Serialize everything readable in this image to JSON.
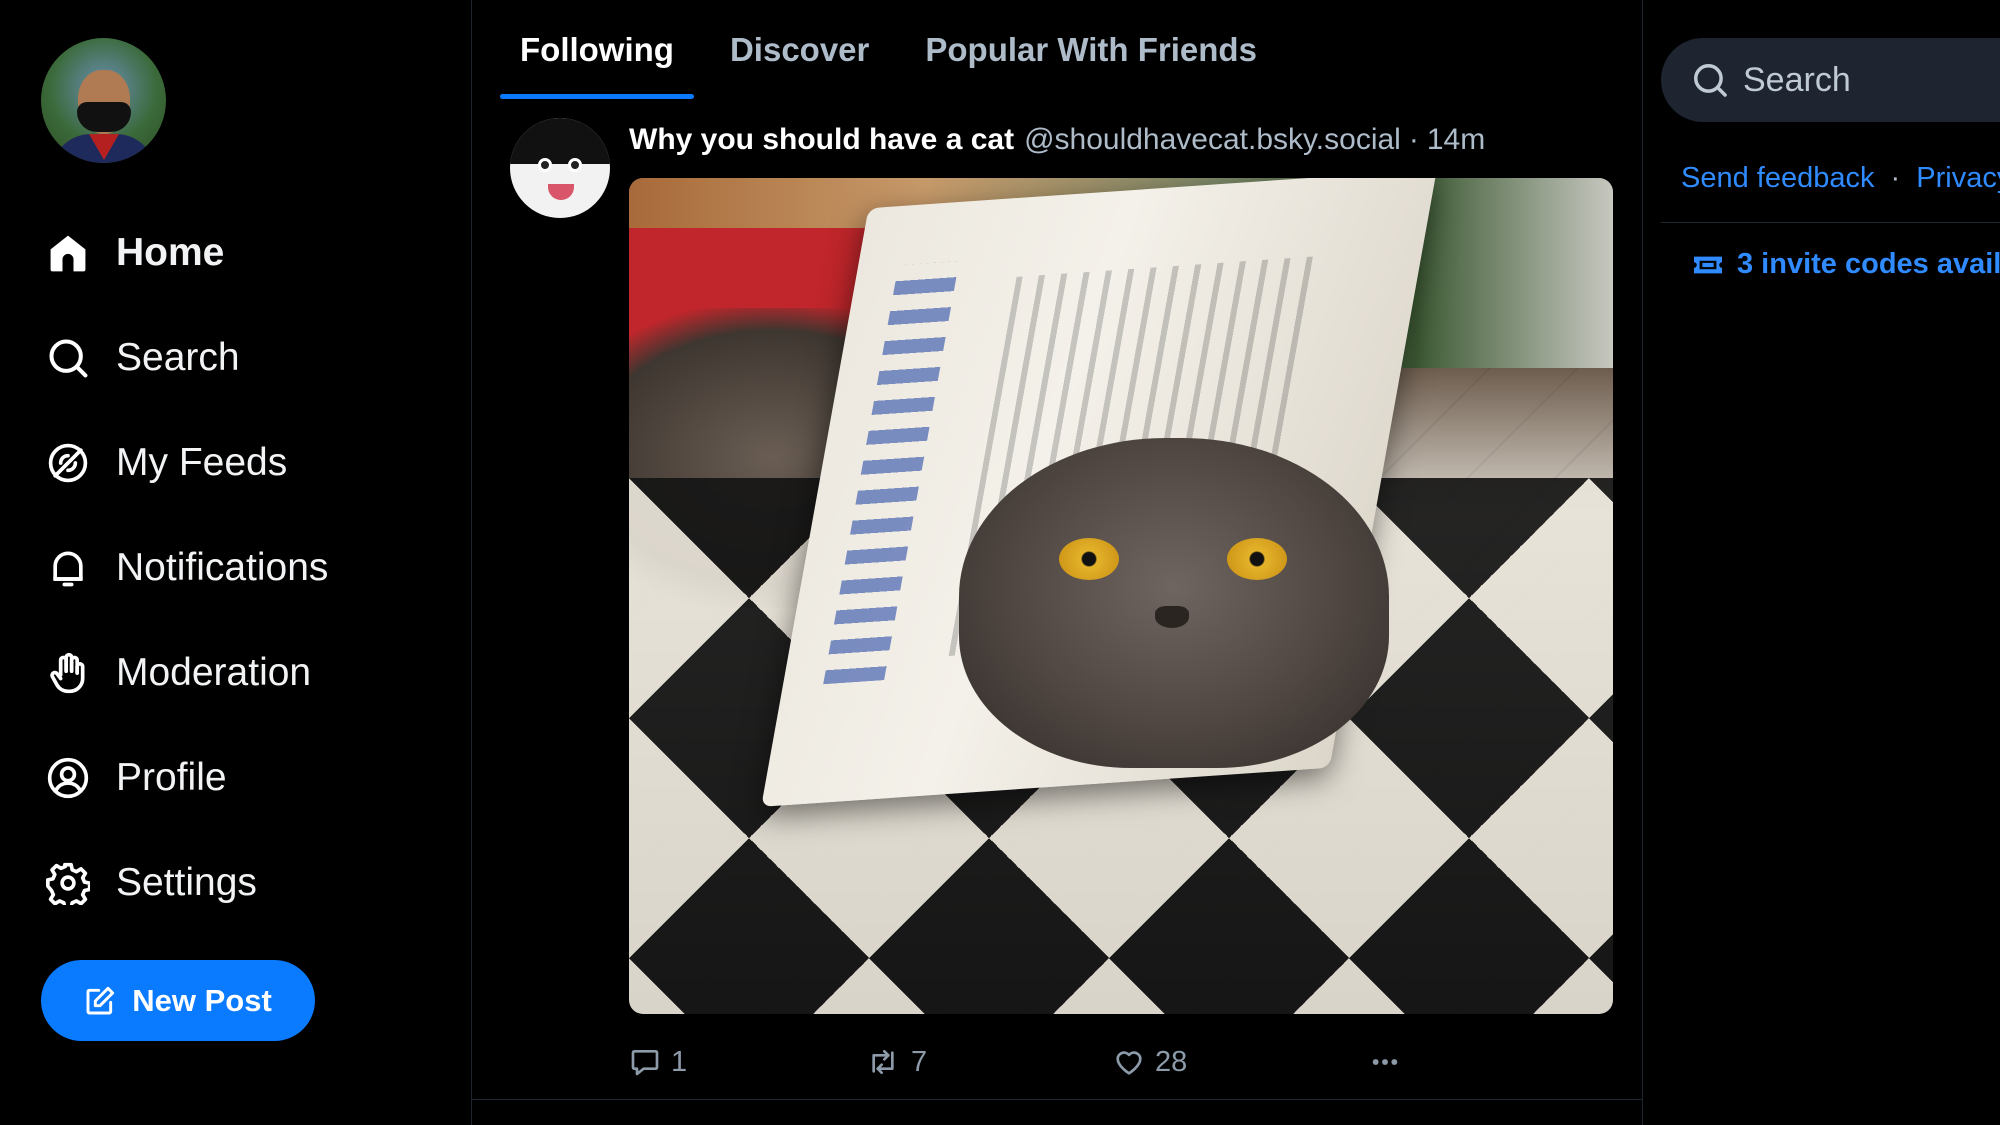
{
  "nav": {
    "items": [
      {
        "label": "Home",
        "icon": "home-icon",
        "active": true
      },
      {
        "label": "Search",
        "icon": "search-icon"
      },
      {
        "label": "My Feeds",
        "icon": "feeds-icon"
      },
      {
        "label": "Notifications",
        "icon": "bell-icon"
      },
      {
        "label": "Moderation",
        "icon": "hand-icon"
      },
      {
        "label": "Profile",
        "icon": "user-circle-icon"
      },
      {
        "label": "Settings",
        "icon": "gear-icon"
      }
    ],
    "new_post_label": "New Post"
  },
  "feed": {
    "tabs": [
      {
        "label": "Following",
        "active": true
      },
      {
        "label": "Discover"
      },
      {
        "label": "Popular With Friends"
      }
    ],
    "post": {
      "author": "Why you should have a cat",
      "handle": "@shouldhavecat.bsky.social",
      "separator": "·",
      "time": "14m",
      "replies": "1",
      "reposts": "7",
      "likes": "28"
    }
  },
  "right": {
    "search_placeholder": "Search",
    "links": {
      "feedback": "Send feedback",
      "separator": "·",
      "privacy": "Privacy"
    },
    "invites": "3 invite codes avail"
  },
  "colors": {
    "accent": "#0a7aff",
    "link": "#2f8bff",
    "background": "#000000",
    "muted": "#8c9aa9"
  }
}
